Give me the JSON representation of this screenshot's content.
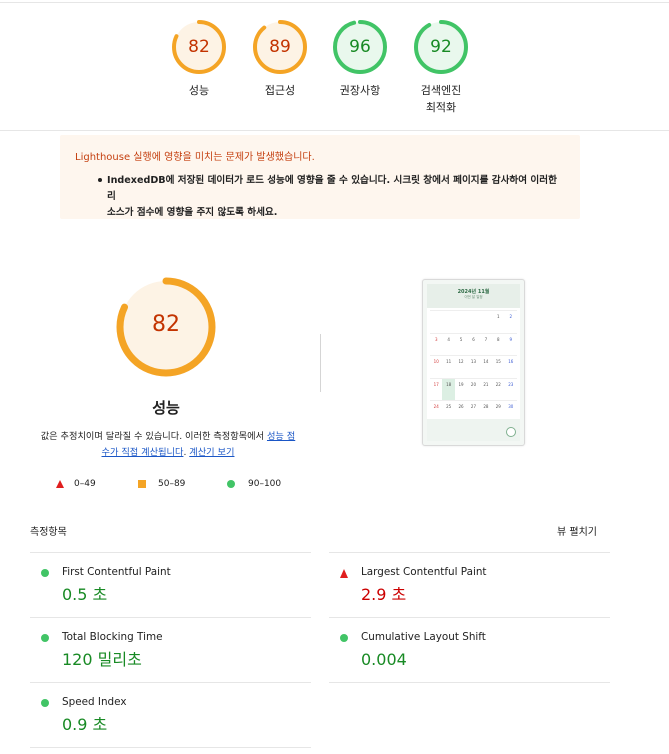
{
  "summary_gauges": [
    {
      "label": "성능",
      "score": "82",
      "score_num": 82,
      "color": "#f4a425",
      "bg": "#fdf3e5",
      "text": "#c33300"
    },
    {
      "label": "접근성",
      "score": "89",
      "score_num": 89,
      "color": "#f4a425",
      "bg": "#fdf3e5",
      "text": "#c33300"
    },
    {
      "label": "권장사항",
      "score": "96",
      "score_num": 96,
      "color": "#41c466",
      "bg": "#e9f8ed",
      "text": "#188a24"
    },
    {
      "label_line1": "검색엔진",
      "label_line2": "최적화",
      "score": "92",
      "score_num": 92,
      "color": "#41c466",
      "bg": "#e9f8ed",
      "text": "#188a24"
    }
  ],
  "warning": {
    "title": "Lighthouse 실행에 영향을 미치는 문제가 발생했습니다.",
    "item_line1": "IndexedDB에 저장된 데이터가 로드 성능에 영향을 줄 수 있습니다. 시크릿 창에서 페이지를 감사하여 이러한 리",
    "item_line2": "소스가 점수에 영향을 주지 않도록 하세요."
  },
  "performance": {
    "score": "82",
    "score_num": 82,
    "title": "성능",
    "desc_prefix": "값은 추정치이며 달라질 수 있습니다. 이러한 측정항목에서 ",
    "desc_link1_a": "성능 점",
    "desc_link1_b": "수가 직접 계산됩니다",
    "desc_mid": ". ",
    "desc_link2": "계산기 보기",
    "legend": [
      {
        "range": "0–49",
        "shape": "triangle",
        "color": "#e01e1e"
      },
      {
        "range": "50–89",
        "shape": "square",
        "color": "#f4a425"
      },
      {
        "range": "90–100",
        "shape": "circle",
        "color": "#41c466"
      }
    ]
  },
  "screenshot": {
    "month": "2024년 11월",
    "subtitle": "이번 달 일정",
    "weeks": [
      [
        "",
        "",
        "",
        "",
        "",
        "1",
        "2"
      ],
      [
        "3",
        "4",
        "5",
        "6",
        "7",
        "8",
        "9"
      ],
      [
        "10",
        "11",
        "12",
        "13",
        "14",
        "15",
        "16"
      ],
      [
        "17",
        "18",
        "19",
        "20",
        "21",
        "22",
        "23"
      ],
      [
        "24",
        "25",
        "26",
        "27",
        "28",
        "29",
        "30"
      ]
    ]
  },
  "metrics": {
    "title": "측정항목",
    "toggle": "뷰 펼치기",
    "items": [
      {
        "name": "First Contentful Paint",
        "value": "0.5 초",
        "status": "pass"
      },
      {
        "name": "Largest Contentful Paint",
        "value": "2.9 초",
        "status": "fail"
      },
      {
        "name": "Total Blocking Time",
        "value": "120 밀리초",
        "status": "pass"
      },
      {
        "name": "Cumulative Layout Shift",
        "value": "0.004",
        "status": "pass"
      },
      {
        "name": "Speed Index",
        "value": "0.9 초",
        "status": "pass"
      }
    ]
  }
}
